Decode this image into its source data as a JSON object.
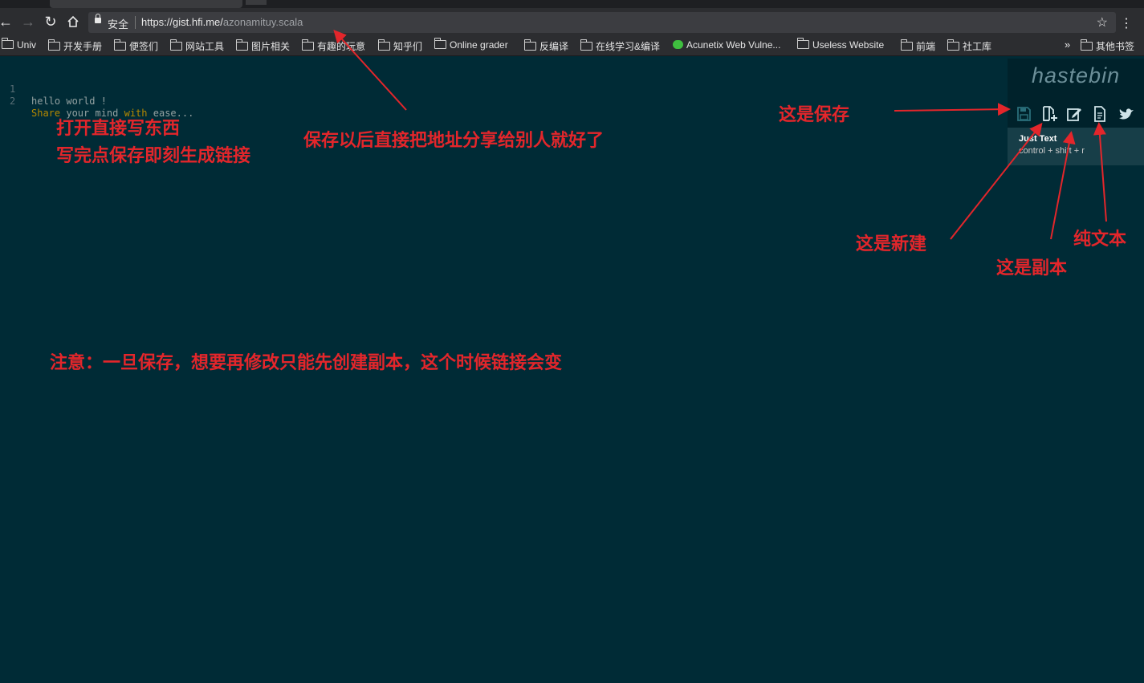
{
  "browser": {
    "security_label": "安全",
    "url_host": "https://gist.hfi.me/",
    "url_path": "azonamituy.scala",
    "more_glyph": "»",
    "bookmarks": [
      {
        "label": "Univ",
        "icon": "folder-icon"
      },
      {
        "label": "开发手册",
        "icon": "folder-icon"
      },
      {
        "label": "便签们",
        "icon": "folder-icon"
      },
      {
        "label": "网站工具",
        "icon": "folder-icon"
      },
      {
        "label": "图片相关",
        "icon": "folder-icon"
      },
      {
        "label": "有趣的玩意",
        "icon": "folder-icon"
      },
      {
        "label": "知乎们",
        "icon": "folder-icon"
      },
      {
        "label": "Online grader",
        "icon": "folder-icon"
      },
      {
        "label": "反编译",
        "icon": "folder-icon"
      },
      {
        "label": "在线学习&编译",
        "icon": "folder-icon"
      },
      {
        "label": "Acunetix Web Vulne...",
        "icon": "wechat-icon"
      },
      {
        "label": "Useless Website",
        "icon": "folder-icon"
      },
      {
        "label": "前端",
        "icon": "folder-icon"
      },
      {
        "label": "社工库",
        "icon": "folder-icon"
      }
    ],
    "other_bookmarks": "其他书签"
  },
  "editor": {
    "lines": [
      {
        "number": "1",
        "text": "hello world !"
      },
      {
        "number": "2",
        "kw1": "Share",
        "mid": " your mind ",
        "kw2": "with",
        "rest": " ease..."
      }
    ]
  },
  "hastebin": {
    "logo": "hastebin",
    "tools": [
      "save-icon",
      "new-icon",
      "duplicate-icon",
      "raw-text-icon",
      "twitter-icon"
    ],
    "hint_title": "Just Text",
    "hint_shortcut": "control + shift + r"
  },
  "annotations": {
    "open_write_1": "打开直接写东西",
    "open_write_2": "写完点保存即刻生成链接",
    "share_after_save": "保存以后直接把地址分享给别人就好了",
    "save": "这是保存",
    "new": "这是新建",
    "duplicate": "这是副本",
    "raw_text": "纯文本",
    "notice": "注意：一旦保存，想要再修改只能先创建副本，这个时候链接会变"
  },
  "colors": {
    "background": "#002b36",
    "annotation": "#e3262b",
    "keyword": "#b58900"
  }
}
